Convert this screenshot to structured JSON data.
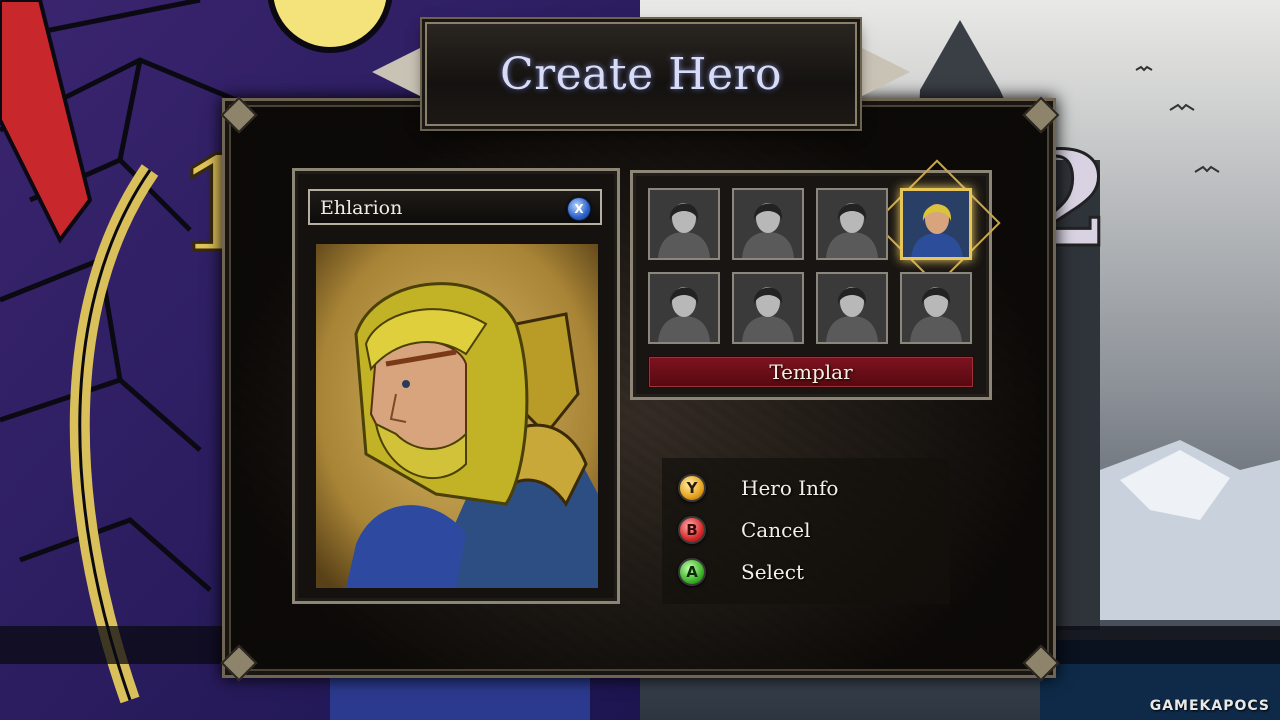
{
  "screen": {
    "title": "Create Hero",
    "watermark": "GAMEKAPOCS"
  },
  "hero": {
    "name": "Ehlarion",
    "name_button_glyph": "X",
    "portrait_icon": "bearded-blonde-warrior-portrait"
  },
  "class_select": {
    "selected_index": 3,
    "selected_label": "Templar",
    "classes": [
      {
        "icon": "hooded-rogue-icon"
      },
      {
        "icon": "barbarian-icon"
      },
      {
        "icon": "hooded-warrior-icon"
      },
      {
        "icon": "templar-icon"
      },
      {
        "icon": "masked-assassin-icon"
      },
      {
        "icon": "archer-woman-icon"
      },
      {
        "icon": "hooded-woman-icon"
      },
      {
        "icon": "armored-woman-icon"
      }
    ]
  },
  "actions": [
    {
      "button": "Y",
      "label": "Hero Info",
      "color": "#e7a21e"
    },
    {
      "button": "B",
      "label": "Cancel",
      "color": "#d52a2a"
    },
    {
      "button": "A",
      "label": "Select",
      "color": "#3fb52c"
    }
  ],
  "colors": {
    "title_glow": "#7e86c8",
    "class_bar": "#7e1320",
    "selection_gold": "#e7c558"
  }
}
